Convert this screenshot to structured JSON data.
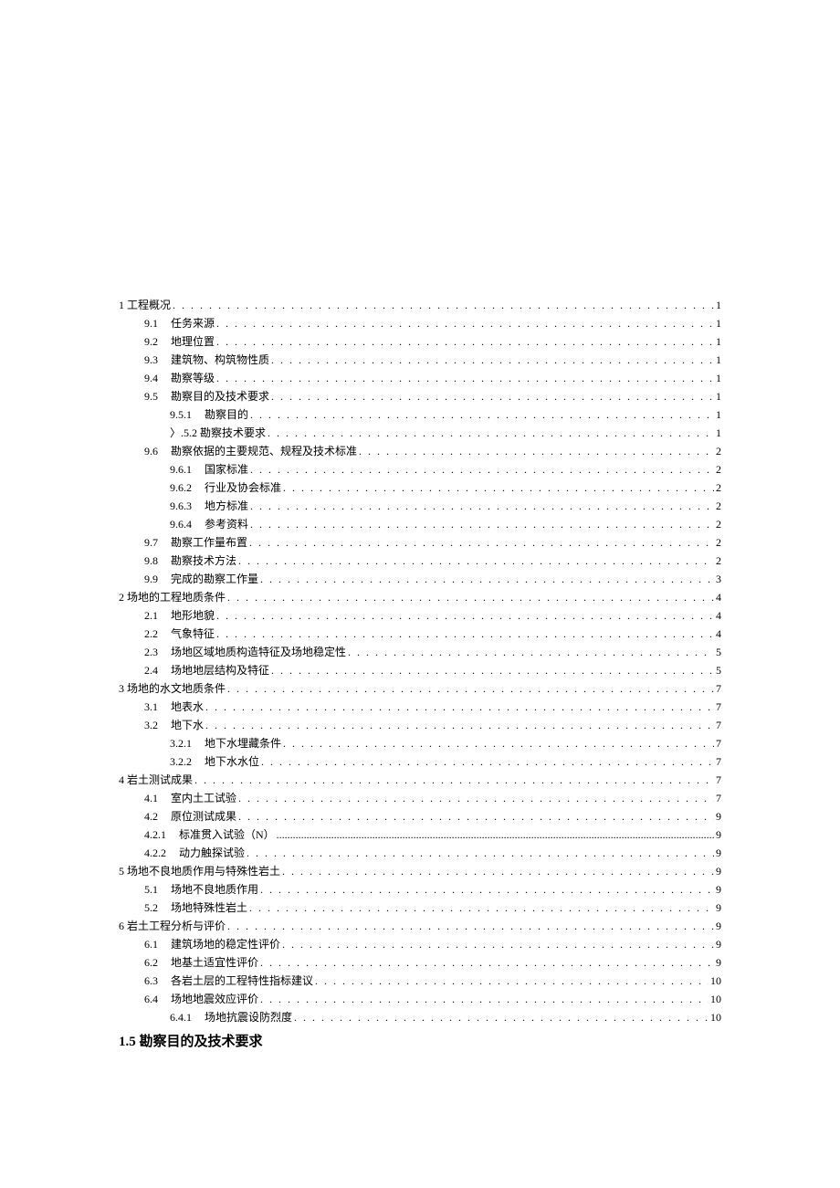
{
  "toc": [
    {
      "level": 0,
      "num": "1",
      "title": "工程概况",
      "page": "1",
      "combined": true
    },
    {
      "level": 1,
      "num": "9.1",
      "title": "任务来源",
      "page": "1"
    },
    {
      "level": 1,
      "num": "9.2",
      "title": "地理位置",
      "page": "1"
    },
    {
      "level": 1,
      "num": "9.3",
      "title": "建筑物、构筑物性质",
      "page": "1"
    },
    {
      "level": 1,
      "num": "9.4",
      "title": "勘察等级",
      "page": "1"
    },
    {
      "level": 1,
      "num": "9.5",
      "title": "勘察目的及技术要求",
      "page": "1"
    },
    {
      "level": 2,
      "num": "9.5.1",
      "title": "勘察目的",
      "page": "1"
    },
    {
      "level": 2,
      "num": "〉.5.2",
      "title": "勘察技术要求",
      "page": "1",
      "combined": true
    },
    {
      "level": 1,
      "num": "9.6",
      "title": "勘察依据的主要规范、规程及技术标准",
      "page": "2"
    },
    {
      "level": 2,
      "num": "9.6.1",
      "title": "国家标准",
      "page": "2"
    },
    {
      "level": 2,
      "num": "9.6.2",
      "title": "行业及协会标准",
      "page": "2"
    },
    {
      "level": 2,
      "num": "9.6.3",
      "title": "地方标准",
      "page": "2"
    },
    {
      "level": 2,
      "num": "9.6.4",
      "title": "参考资料",
      "page": "2"
    },
    {
      "level": 1,
      "num": "9.7",
      "title": "勘察工作量布置",
      "page": "2"
    },
    {
      "level": 1,
      "num": "9.8",
      "title": "勘察技术方法",
      "page": "2"
    },
    {
      "level": 1,
      "num": "9.9",
      "title": "完成的勘察工作量",
      "page": "3"
    },
    {
      "level": 0,
      "num": "2",
      "title": "场地的工程地质条件",
      "page": "4",
      "combined": true
    },
    {
      "level": 1,
      "num": "2.1",
      "title": "地形地貌",
      "page": "4"
    },
    {
      "level": 1,
      "num": "2.2",
      "title": "气象特征",
      "page": "4"
    },
    {
      "level": 1,
      "num": "2.3",
      "title": "场地区域地质构造特征及场地稳定性",
      "page": "5"
    },
    {
      "level": 1,
      "num": "2.4",
      "title": "场地地层结构及特征",
      "page": "5"
    },
    {
      "level": 0,
      "num": "3",
      "title": "场地的水文地质条件",
      "page": "7",
      "combined": true
    },
    {
      "level": 1,
      "num": "3.1",
      "title": "地表水",
      "page": "7"
    },
    {
      "level": 1,
      "num": "3.2",
      "title": "地下水",
      "page": "7"
    },
    {
      "level": 2,
      "num": "3.2.1",
      "title": "地下水埋藏条件",
      "page": "7"
    },
    {
      "level": 2,
      "num": "3.2.2",
      "title": "地下水水位",
      "page": "7"
    },
    {
      "level": 0,
      "num": "4",
      "title": "岩土测试成果",
      "page": "7",
      "combined": true
    },
    {
      "level": 1,
      "num": "4.1",
      "title": "室内土工试验",
      "page": "7"
    },
    {
      "level": 1,
      "num": "4.2",
      "title": "原位测试成果",
      "page": "9"
    },
    {
      "level": 1,
      "num": "4.2.1",
      "title": "标准贯入试验（N）",
      "page": "9",
      "fine": true
    },
    {
      "level": 1,
      "num": "4.2.2",
      "title": "动力触探试验",
      "page": "9"
    },
    {
      "level": 0,
      "num": "5",
      "title": "场地不良地质作用与特殊性岩土",
      "page": "9",
      "combined": true
    },
    {
      "level": 1,
      "num": "5.1",
      "title": "场地不良地质作用",
      "page": "9"
    },
    {
      "level": 1,
      "num": "5.2",
      "title": "场地特殊性岩土",
      "page": "9"
    },
    {
      "level": 0,
      "num": "6",
      "title": "岩土工程分析与评价",
      "page": "9",
      "combined": true
    },
    {
      "level": 1,
      "num": "6.1",
      "title": "建筑场地的稳定性评价",
      "page": "9"
    },
    {
      "level": 1,
      "num": "6.2",
      "title": "地基土适宜性评价",
      "page": "9"
    },
    {
      "level": 1,
      "num": "6.3",
      "title": "各岩土层的工程特性指标建议",
      "page": "10"
    },
    {
      "level": 1,
      "num": "6.4",
      "title": "场地地震效应评价",
      "page": "10"
    },
    {
      "level": 2,
      "num": "6.4.1",
      "title": "场地抗震设防烈度",
      "page": "10"
    }
  ],
  "heading": "1.5 勘察目的及技术要求"
}
